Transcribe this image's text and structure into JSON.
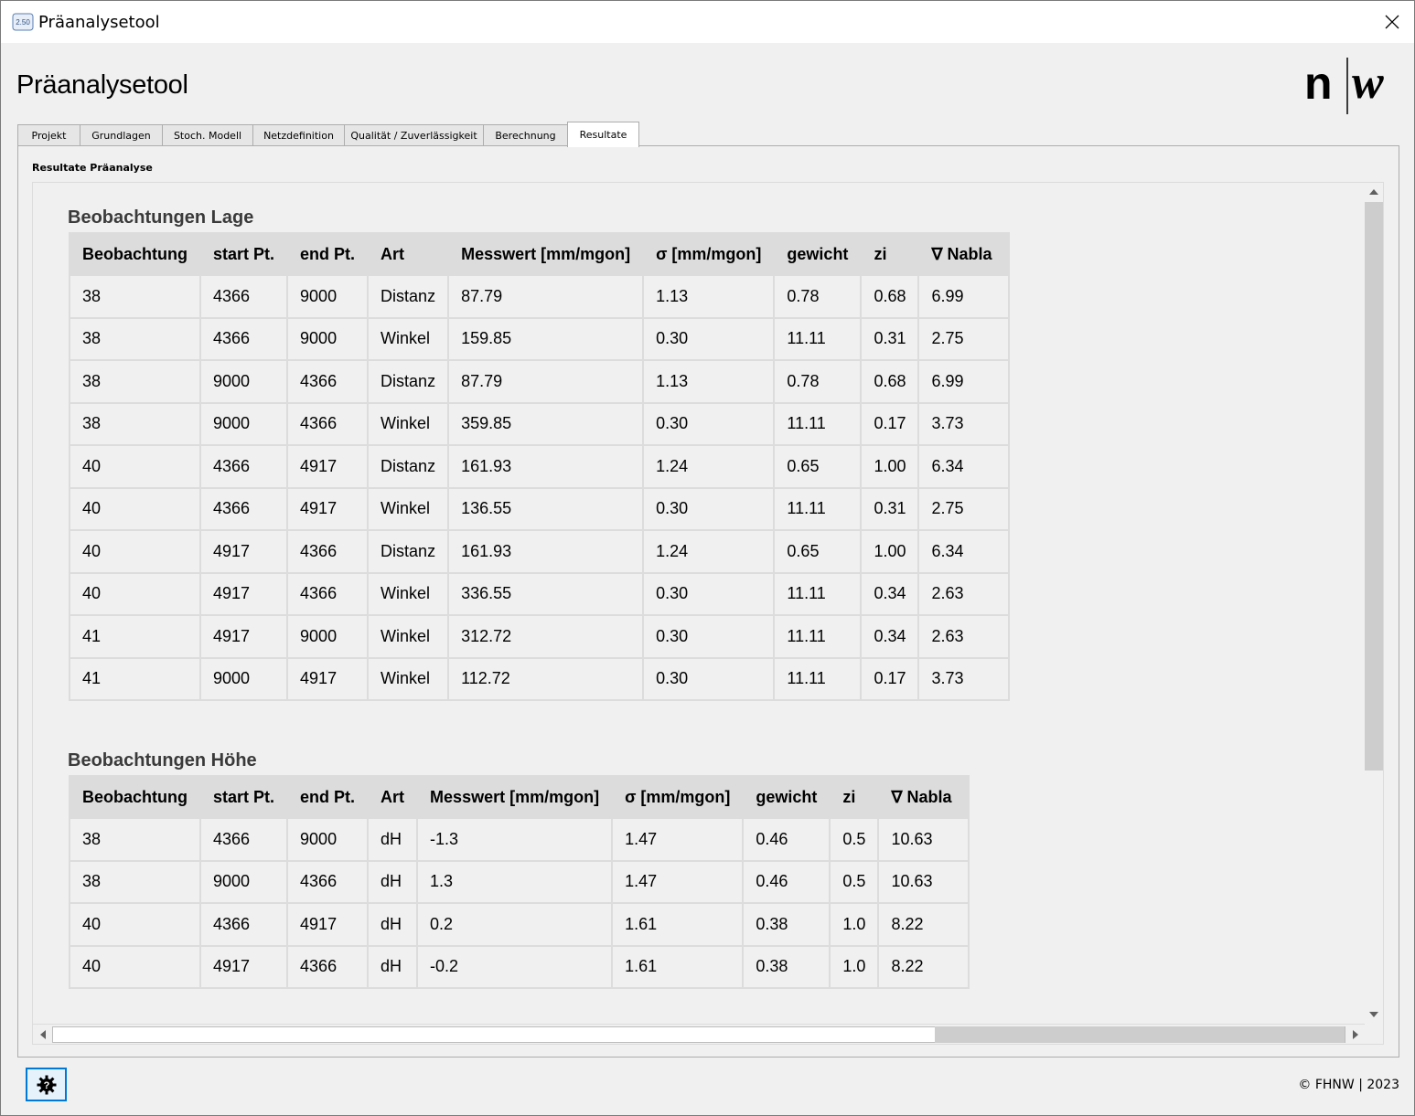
{
  "window": {
    "title": "Präanalysetool",
    "version_badge": "2.50"
  },
  "header": {
    "title": "Präanalysetool",
    "logo_left": "n",
    "logo_right": "w"
  },
  "tabs": [
    {
      "label": "Projekt"
    },
    {
      "label": "Grundlagen"
    },
    {
      "label": "Stoch. Modell"
    },
    {
      "label": "Netzdefinition"
    },
    {
      "label": "Qualität / Zuverlässigkeit"
    },
    {
      "label": "Berechnung"
    },
    {
      "label": "Resultate",
      "active": true
    }
  ],
  "panel": {
    "section_label": "Resultate Präanalyse"
  },
  "lage": {
    "title": "Beobachtungen Lage",
    "columns": [
      "Beobachtung",
      "start Pt.",
      "end Pt.",
      "Art",
      "Messwert [mm/mgon]",
      "σ [mm/mgon]",
      "gewicht",
      "zi",
      "∇ Nabla"
    ],
    "rows": [
      [
        "38",
        "4366",
        "9000",
        "Distanz",
        "87.79",
        "1.13",
        "0.78",
        "0.68",
        "6.99"
      ],
      [
        "38",
        "4366",
        "9000",
        "Winkel",
        "159.85",
        "0.30",
        "11.11",
        "0.31",
        "2.75"
      ],
      [
        "38",
        "9000",
        "4366",
        "Distanz",
        "87.79",
        "1.13",
        "0.78",
        "0.68",
        "6.99"
      ],
      [
        "38",
        "9000",
        "4366",
        "Winkel",
        "359.85",
        "0.30",
        "11.11",
        "0.17",
        "3.73"
      ],
      [
        "40",
        "4366",
        "4917",
        "Distanz",
        "161.93",
        "1.24",
        "0.65",
        "1.00",
        "6.34"
      ],
      [
        "40",
        "4366",
        "4917",
        "Winkel",
        "136.55",
        "0.30",
        "11.11",
        "0.31",
        "2.75"
      ],
      [
        "40",
        "4917",
        "4366",
        "Distanz",
        "161.93",
        "1.24",
        "0.65",
        "1.00",
        "6.34"
      ],
      [
        "40",
        "4917",
        "4366",
        "Winkel",
        "336.55",
        "0.30",
        "11.11",
        "0.34",
        "2.63"
      ],
      [
        "41",
        "4917",
        "9000",
        "Winkel",
        "312.72",
        "0.30",
        "11.11",
        "0.34",
        "2.63"
      ],
      [
        "41",
        "9000",
        "4917",
        "Winkel",
        "112.72",
        "0.30",
        "11.11",
        "0.17",
        "3.73"
      ]
    ]
  },
  "hoehe": {
    "title": "Beobachtungen Höhe",
    "columns": [
      "Beobachtung",
      "start Pt.",
      "end Pt.",
      "Art",
      "Messwert [mm/mgon]",
      "σ [mm/mgon]",
      "gewicht",
      "zi",
      "∇ Nabla"
    ],
    "rows": [
      [
        "38",
        "4366",
        "9000",
        "dH",
        "-1.3",
        "1.47",
        "0.46",
        "0.5",
        "10.63"
      ],
      [
        "38",
        "9000",
        "4366",
        "dH",
        "1.3",
        "1.47",
        "0.46",
        "0.5",
        "10.63"
      ],
      [
        "40",
        "4366",
        "4917",
        "dH",
        "0.2",
        "1.61",
        "0.38",
        "1.0",
        "8.22"
      ],
      [
        "40",
        "4917",
        "4366",
        "dH",
        "-0.2",
        "1.61",
        "0.38",
        "1.0",
        "8.22"
      ]
    ]
  },
  "footer": {
    "copyright": "© FHNW | 2023"
  },
  "icons": {
    "close": "close-icon",
    "help": "help-gear-icon",
    "app": "app-icon"
  },
  "colors": {
    "accent": "#0078d7",
    "header_row": "#dcdcdc",
    "background": "#f0f0f0"
  }
}
